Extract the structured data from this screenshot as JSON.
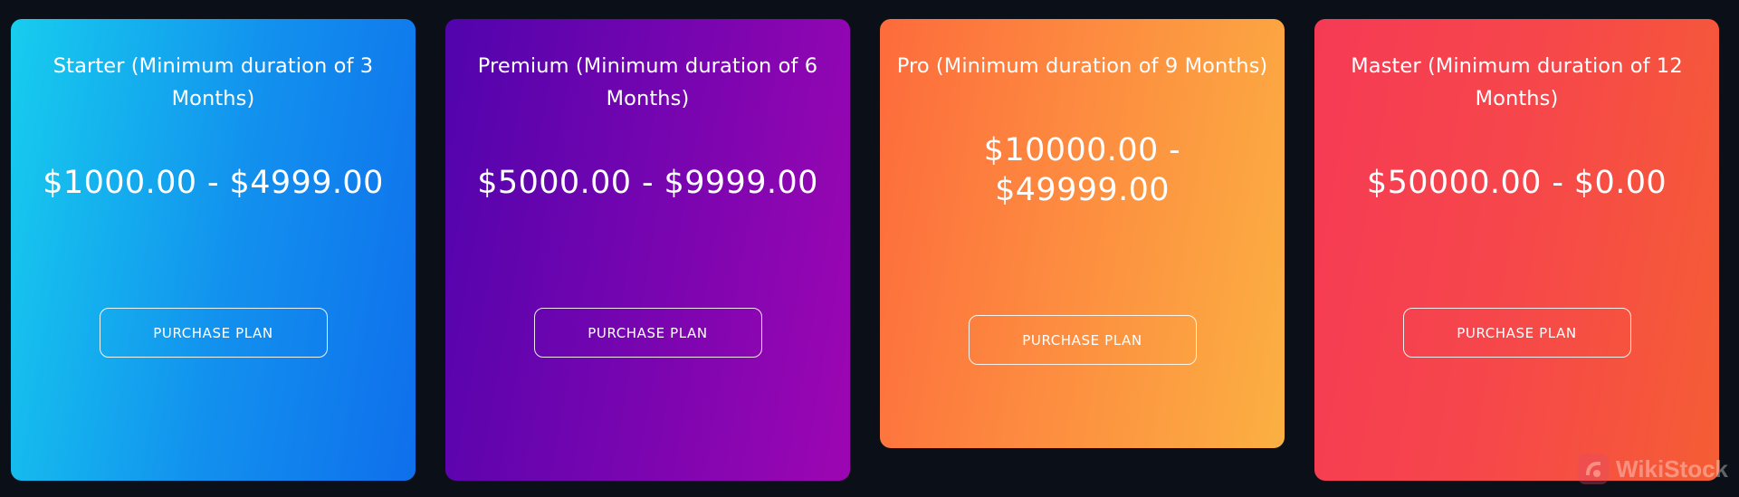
{
  "plans": [
    {
      "title": "Starter (Minimum duration of 3 Months)",
      "price": "$1000.00 - $4999.00",
      "button_label": "PURCHASE PLAN"
    },
    {
      "title": "Premium (Minimum duration of 6 Months)",
      "price": "$5000.00 - $9999.00",
      "button_label": "PURCHASE PLAN"
    },
    {
      "title": "Pro (Minimum duration of 9 Months)",
      "price": "$10000.00 - $49999.00",
      "button_label": "PURCHASE PLAN"
    },
    {
      "title": "Master (Minimum duration of 12 Months)",
      "price": "$50000.00 - $0.00",
      "button_label": "PURCHASE PLAN"
    }
  ],
  "watermark": {
    "text": "WikiStock",
    "icon": "wikistock-logo-icon"
  },
  "colors": {
    "background": "#0b0f17",
    "starter": [
      "#17cdee",
      "#0f6fec"
    ],
    "premium": [
      "#5104ad",
      "#9d06b2"
    ],
    "pro": [
      "#fd6b3c",
      "#fbb042"
    ],
    "master": [
      "#f63a55",
      "#f55e34"
    ]
  }
}
